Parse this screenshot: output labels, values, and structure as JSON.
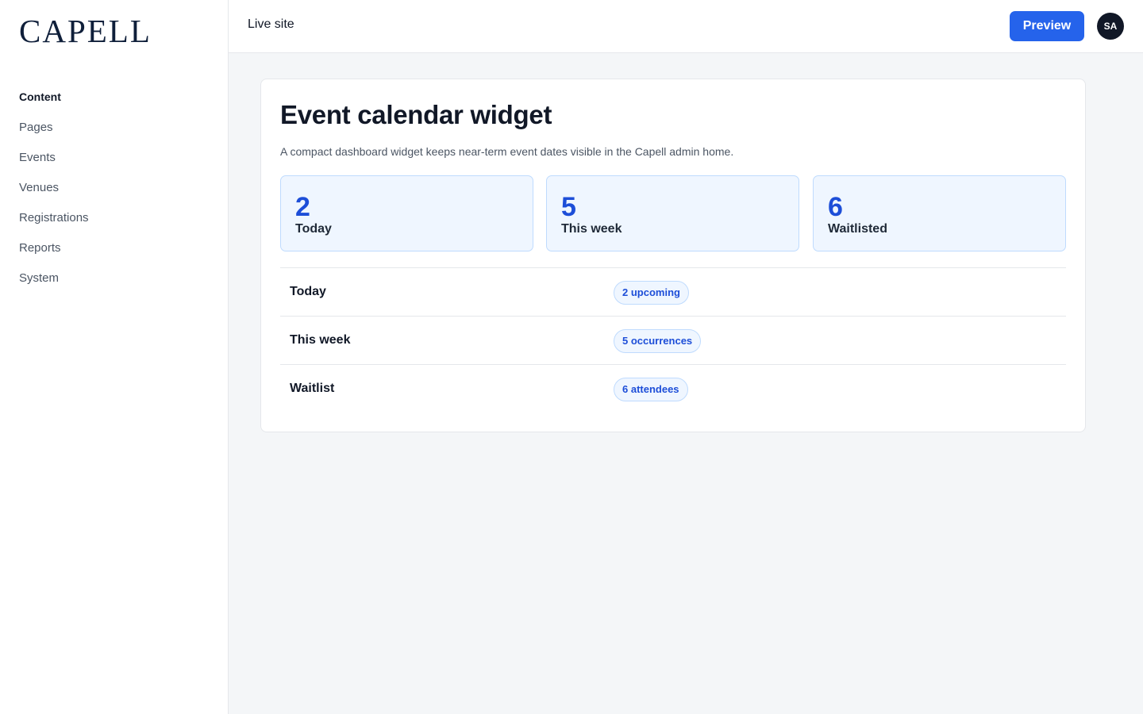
{
  "brand": {
    "logo_text": "CAPELL"
  },
  "sidebar": {
    "section_heading": "Content",
    "items": [
      {
        "label": "Pages"
      },
      {
        "label": "Events"
      },
      {
        "label": "Venues"
      },
      {
        "label": "Registrations"
      },
      {
        "label": "Reports"
      },
      {
        "label": "System"
      }
    ]
  },
  "topbar": {
    "live_site_label": "Live site",
    "preview_label": "Preview",
    "avatar_initials": "SA"
  },
  "widget": {
    "title": "Event calendar widget",
    "description": "A compact dashboard widget keeps near-term event dates visible in the Capell admin home.",
    "stats": [
      {
        "value": "2",
        "label": "Today"
      },
      {
        "value": "5",
        "label": "This week"
      },
      {
        "value": "6",
        "label": "Waitlisted"
      }
    ],
    "rows": [
      {
        "label": "Today",
        "badge": "2 upcoming"
      },
      {
        "label": "This week",
        "badge": "5 occurrences"
      },
      {
        "label": "Waitlist",
        "badge": "6 attendees"
      }
    ]
  },
  "colors": {
    "accent": "#2563eb",
    "stat_value": "#1d4ed8",
    "stat_background": "#eff6ff",
    "page_background": "#f4f6f8",
    "avatar_background": "#111827"
  }
}
